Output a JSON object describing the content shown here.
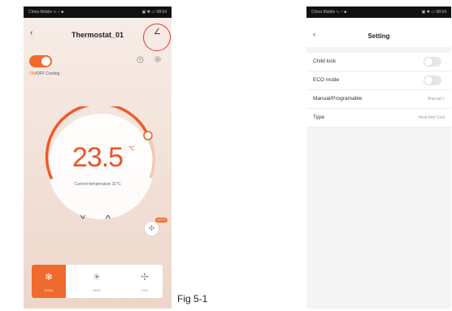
{
  "status_bar": {
    "carrier": "China Mobile ⁸ᵢₗ ◔ ■",
    "right": "▣ ✱ ▭ 08:54"
  },
  "thermostat": {
    "title": "Thermostat_01",
    "back": "‹",
    "edit_glyph": "∠",
    "power": {
      "on": true,
      "label_on": "ON",
      "label_off": "/OFF",
      "label_mode": " Cooling"
    },
    "set_temperature": "23.5",
    "unit": "℃",
    "current_temperature_text": "Current temperature 31°C",
    "fan_badge": "AUTO",
    "modes": [
      {
        "label": "COOL",
        "glyph": "❄",
        "active": true
      },
      {
        "label": "HEAT",
        "glyph": "☀",
        "active": false
      },
      {
        "label": "FAN",
        "glyph": "✢",
        "active": false
      }
    ],
    "accent_color": "#ef6b2d",
    "icons": [
      "back-icon",
      "edit-icon",
      "clock-icon",
      "gear-icon",
      "chevron-down-icon",
      "chevron-up-icon",
      "fan-icon"
    ]
  },
  "setting": {
    "title": "Setting",
    "back": "‹",
    "rows": [
      {
        "label": "Child lock",
        "type": "switch",
        "on": false
      },
      {
        "label": "ECO mode",
        "type": "switch",
        "on": false
      },
      {
        "label": "Manual/Programable",
        "type": "value",
        "value": "Manual  >"
      },
      {
        "label": "Type",
        "type": "value",
        "value": "Heat And Cool"
      }
    ]
  },
  "caption": "Fig 5-1"
}
